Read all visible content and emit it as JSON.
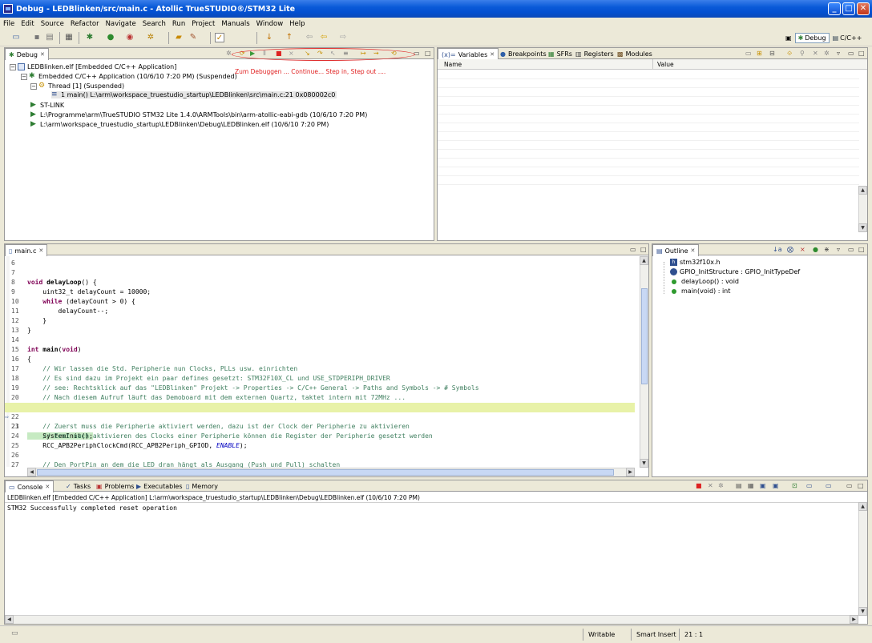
{
  "window": {
    "title": "Debug - LEDBlinken/src/main.c - Atollic TrueSTUDIO®/STM32 Lite",
    "minimize_label": "_",
    "maximize_label": "□",
    "close_label": "✕"
  },
  "menu": [
    "File",
    "Edit",
    "Source",
    "Refactor",
    "Navigate",
    "Search",
    "Run",
    "Project",
    "Manuals",
    "Window",
    "Help"
  ],
  "perspectives": {
    "debug": "Debug",
    "cpp": "C/C++"
  },
  "debug_panel": {
    "tab": "Debug",
    "annotation": "Zum Debuggen ... Continue... Step in, Step out ....",
    "tree": [
      "LEDBlinken.elf [Embedded C/C++ Application]",
      "Embedded C/C++ Application (10/6/10 7:20 PM) (Suspended)",
      "Thread [1] (Suspended)",
      "1 main() L:\\arm\\workspace_truestudio_startup\\LEDBlinken\\src\\main.c:21 0x080002c0",
      "ST-LINK",
      "L:\\Programme\\arm\\TrueSTUDIO STM32 Lite 1.4.0\\ARMTools\\bin\\arm-atollic-eabi-gdb (10/6/10 7:20 PM)",
      "L:\\arm\\workspace_truestudio_startup\\LEDBlinken\\Debug\\LEDBlinken.elf (10/6/10 7:20 PM)"
    ]
  },
  "variables_panel": {
    "tabs": [
      "Variables",
      "Breakpoints",
      "SFRs",
      "Registers",
      "Modules"
    ],
    "col_name": "Name",
    "col_value": "Value"
  },
  "editor": {
    "tab": "main.c",
    "lines": [
      {
        "n": "6",
        "t": ""
      },
      {
        "n": "7",
        "t": ""
      },
      {
        "n": "8",
        "t": "void delayLoop() {"
      },
      {
        "n": "9",
        "t": "    uint32_t delayCount = 10000;"
      },
      {
        "n": "10",
        "t": "    while (delayCount > 0) {"
      },
      {
        "n": "11",
        "t": "        delayCount--;"
      },
      {
        "n": "12",
        "t": "    }"
      },
      {
        "n": "13",
        "t": "}"
      },
      {
        "n": "14",
        "t": ""
      },
      {
        "n": "15",
        "t": "int main(void)"
      },
      {
        "n": "16",
        "t": "{"
      },
      {
        "n": "17",
        "t": "    // Wir lassen die Std. Peripherie nun Clocks, PLLs usw. einrichten"
      },
      {
        "n": "18",
        "t": "    // Es sind dazu im Projekt ein paar defines gesetzt: STM32F10X_CL und USE_STDPERIPH_DRIVER"
      },
      {
        "n": "19",
        "t": "    // see: Rechtsklick auf das \"LEDBlinken\" Projekt -> Properties -> C/C++ General -> Paths and Symbols -> # Symbols"
      },
      {
        "n": "20",
        "t": "    // Nach diesem Aufruf läuft das Demoboard mit dem externen Quartz, taktet intern mit 72MHz ..."
      },
      {
        "n": "21",
        "t": "    SystemInit();"
      },
      {
        "n": "22",
        "t": ""
      },
      {
        "n": "23",
        "t": "    // Zuerst muss die Peripherie aktiviert werden, dazu ist der Clock der Peripherie zu aktivieren"
      },
      {
        "n": "24",
        "t": "    // Erst nach aktivieren des Clocks einer Peripherie können die Register der Peripherie gesetzt werden"
      },
      {
        "n": "25",
        "t": "    RCC_APB2PeriphClockCmd(RCC_APB2Periph_GPIOD, ENABLE);"
      },
      {
        "n": "26",
        "t": ""
      },
      {
        "n": "27",
        "t": "    // Den PortPin an dem die LED dran hängt als Ausgang (Push und Pull) schalten"
      }
    ]
  },
  "outline": {
    "tab": "Outline",
    "items": [
      "stm32f10x.h",
      "GPIO_InitStructure : GPIO_InitTypeDef",
      "delayLoop() : void",
      "main(void) : int"
    ]
  },
  "console": {
    "tabs": [
      "Console",
      "Tasks",
      "Problems",
      "Executables",
      "Memory"
    ],
    "info": "LEDBlinken.elf [Embedded C/C++ Application] L:\\arm\\workspace_truestudio_startup\\LEDBlinken\\Debug\\LEDBlinken.elf (10/6/10 7:20 PM)",
    "output": "STM32 Successfully completed reset operation"
  },
  "status": {
    "mode": "Writable",
    "insert": "Smart Insert",
    "position": "21 : 1"
  },
  "colors": {
    "title_blue": "#0450d0",
    "keyword": "#7f0055",
    "comment": "#3f7f5f",
    "annotation_red": "#e02020"
  }
}
